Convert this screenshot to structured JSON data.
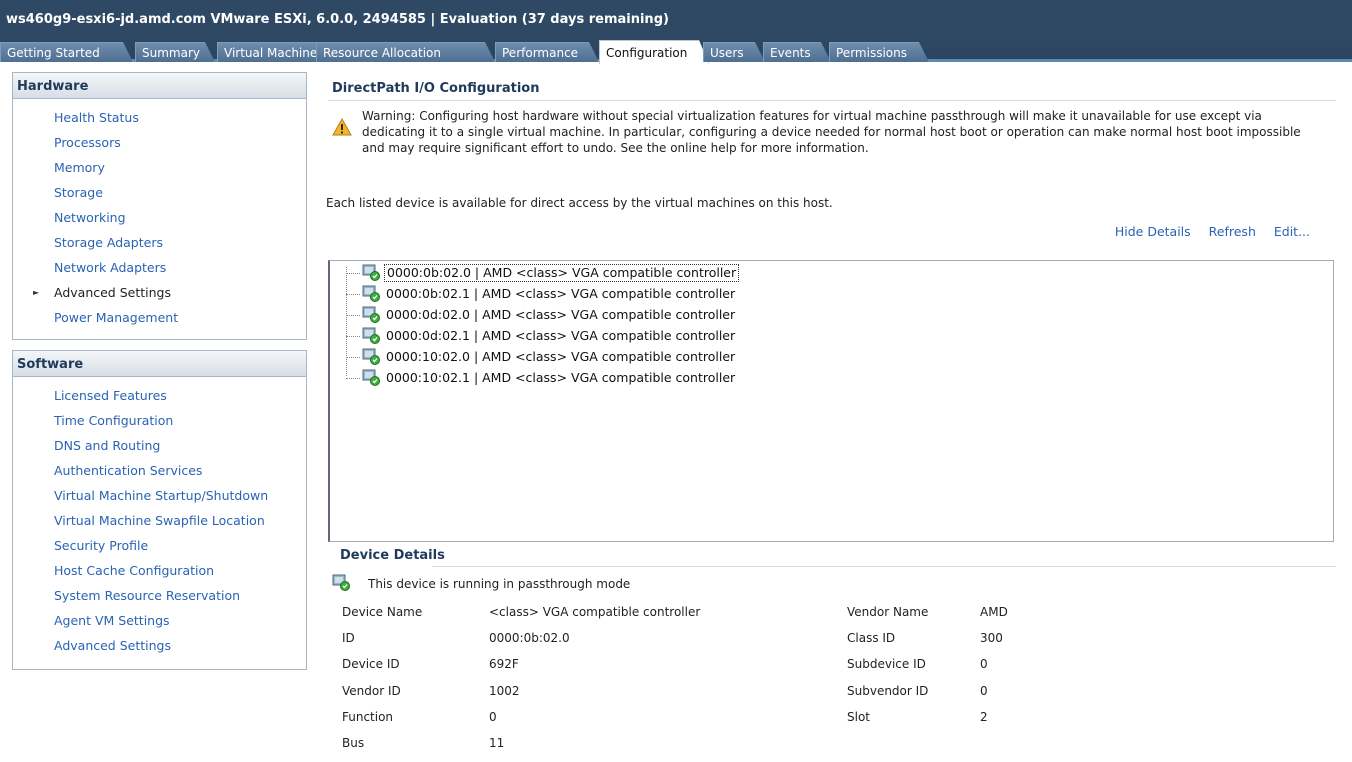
{
  "window": {
    "title": "ws460g9-esxi6-jd.amd.com VMware ESXi, 6.0.0, 2494585 | Evaluation (37 days remaining)"
  },
  "tabs": [
    {
      "label": "Getting Started"
    },
    {
      "label": "Summary"
    },
    {
      "label": "Virtual Machines"
    },
    {
      "label": "Resource Allocation"
    },
    {
      "label": "Performance"
    },
    {
      "label": "Configuration",
      "active": true
    },
    {
      "label": "Users"
    },
    {
      "label": "Events"
    },
    {
      "label": "Permissions"
    }
  ],
  "hardware": {
    "header": "Hardware",
    "items": [
      {
        "label": "Health Status"
      },
      {
        "label": "Processors"
      },
      {
        "label": "Memory"
      },
      {
        "label": "Storage"
      },
      {
        "label": "Networking"
      },
      {
        "label": "Storage Adapters"
      },
      {
        "label": "Network Adapters"
      },
      {
        "label": "Advanced Settings"
      },
      {
        "label": "Power Management"
      }
    ]
  },
  "software": {
    "header": "Software",
    "items": [
      {
        "label": "Licensed Features"
      },
      {
        "label": "Time Configuration"
      },
      {
        "label": "DNS and Routing"
      },
      {
        "label": "Authentication Services"
      },
      {
        "label": "Virtual Machine Startup/Shutdown"
      },
      {
        "label": "Virtual Machine Swapfile Location"
      },
      {
        "label": "Security Profile"
      },
      {
        "label": "Host Cache Configuration"
      },
      {
        "label": "System Resource Reservation"
      },
      {
        "label": "Agent VM Settings"
      },
      {
        "label": "Advanced Settings"
      }
    ]
  },
  "main": {
    "title": "DirectPath I/O Configuration",
    "warning": "Warning: Configuring host hardware without special virtualization features for virtual machine passthrough will make it unavailable for use except via dedicating it to a single virtual machine. In particular, configuring a device needed for normal host boot or operation can make normal host boot impossible and may require significant effort to undo. See the online help for more information.",
    "description": "Each listed device is available for direct access by the virtual machines on this host.",
    "links": {
      "hide_details": "Hide Details",
      "refresh": "Refresh",
      "edit": "Edit..."
    },
    "devices": [
      {
        "label": "0000:0b:02.0 | AMD <class> VGA compatible controller"
      },
      {
        "label": "0000:0b:02.1 | AMD <class> VGA compatible controller"
      },
      {
        "label": "0000:0d:02.0 | AMD <class> VGA compatible controller"
      },
      {
        "label": "0000:0d:02.1 | AMD <class> VGA compatible controller"
      },
      {
        "label": "0000:10:02.0 | AMD <class> VGA compatible controller"
      },
      {
        "label": "0000:10:02.1 | AMD <class> VGA compatible controller"
      }
    ]
  },
  "details": {
    "title": "Device Details",
    "status": "This device is running in passthrough mode",
    "left": [
      {
        "label": "Device Name",
        "value": "<class> VGA compatible controller"
      },
      {
        "label": "ID",
        "value": "0000:0b:02.0"
      },
      {
        "label": "Device ID",
        "value": "692F"
      },
      {
        "label": "Vendor ID",
        "value": "1002"
      },
      {
        "label": "Function",
        "value": "0"
      },
      {
        "label": "Bus",
        "value": "11"
      }
    ],
    "right": [
      {
        "label": "Vendor Name",
        "value": "AMD"
      },
      {
        "label": "Class ID",
        "value": "300"
      },
      {
        "label": "Subdevice ID",
        "value": "0"
      },
      {
        "label": "Subvendor ID",
        "value": "0"
      },
      {
        "label": "Slot",
        "value": "2"
      }
    ]
  }
}
